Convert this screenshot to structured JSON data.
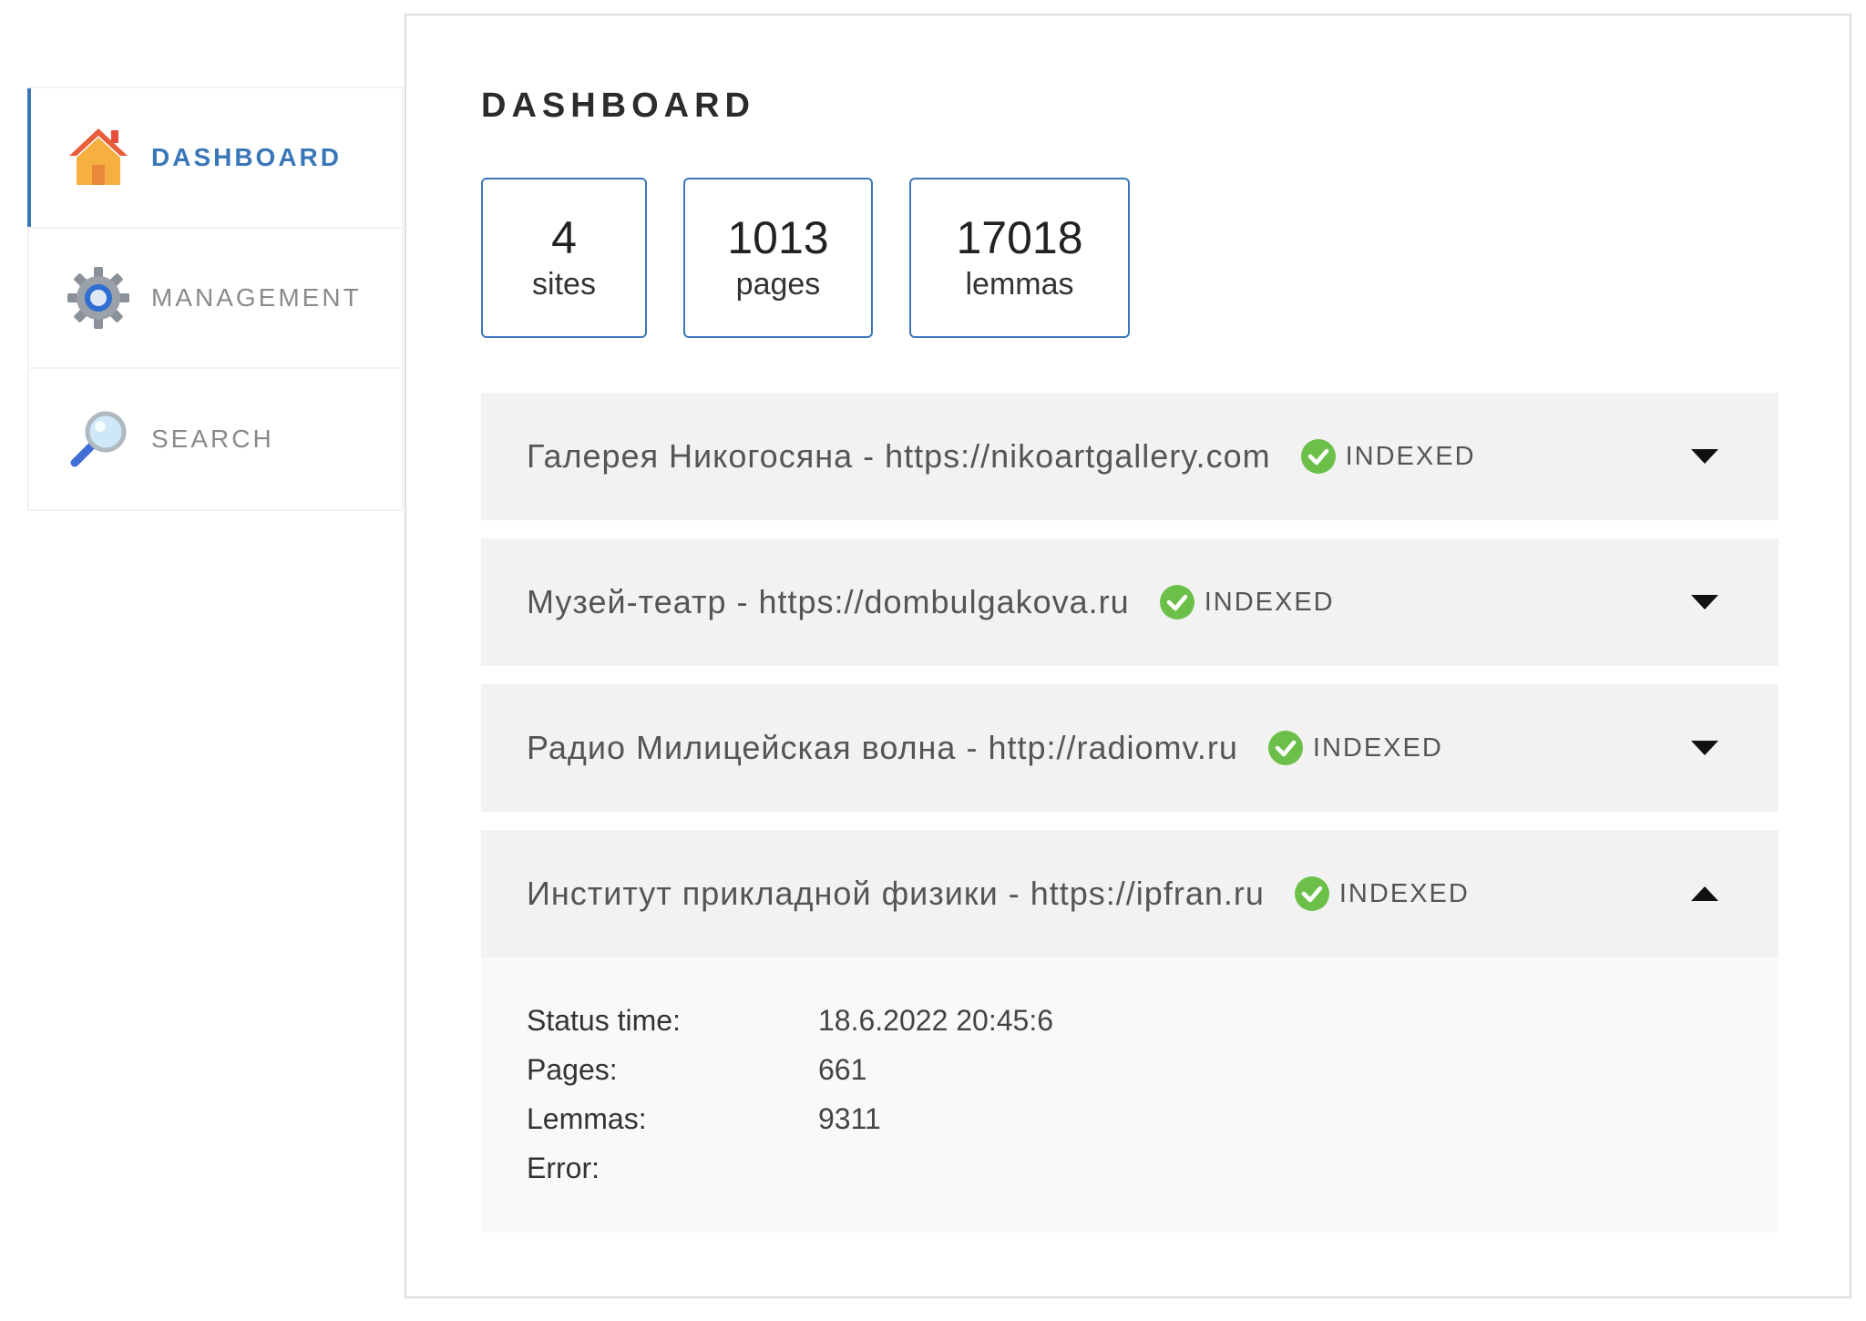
{
  "sidebar": {
    "items": [
      {
        "label": "DASHBOARD",
        "icon": "home-icon",
        "active": true
      },
      {
        "label": "MANAGEMENT",
        "icon": "gear-icon",
        "active": false
      },
      {
        "label": "SEARCH",
        "icon": "magnifier-icon",
        "active": false
      }
    ]
  },
  "main": {
    "title": "DASHBOARD",
    "stats": [
      {
        "value": "4",
        "label": "sites"
      },
      {
        "value": "1013",
        "label": "pages"
      },
      {
        "value": "17018",
        "label": "lemmas"
      }
    ],
    "sites": [
      {
        "title": "Галерея Никогосяна - https://nikoartgallery.com",
        "status": "INDEXED",
        "expanded": false
      },
      {
        "title": "Музей-театр - https://dombulgakova.ru",
        "status": "INDEXED",
        "expanded": false
      },
      {
        "title": "Радио Милицейская волна - http://radiomv.ru",
        "status": "INDEXED",
        "expanded": false
      },
      {
        "title": "Институт прикладной физики - https://ipfran.ru",
        "status": "INDEXED",
        "expanded": true,
        "details": {
          "status_time_label": "Status time:",
          "status_time": "18.6.2022 20:45:6",
          "pages_label": "Pages:",
          "pages": "661",
          "lemmas_label": "Lemmas:",
          "lemmas": "9311",
          "error_label": "Error:",
          "error": ""
        }
      }
    ]
  },
  "colors": {
    "accent": "#3a77b8",
    "status_ok": "#6cc04a",
    "header_bg": "#f2f2f2",
    "body_bg": "#f9f9f9"
  }
}
